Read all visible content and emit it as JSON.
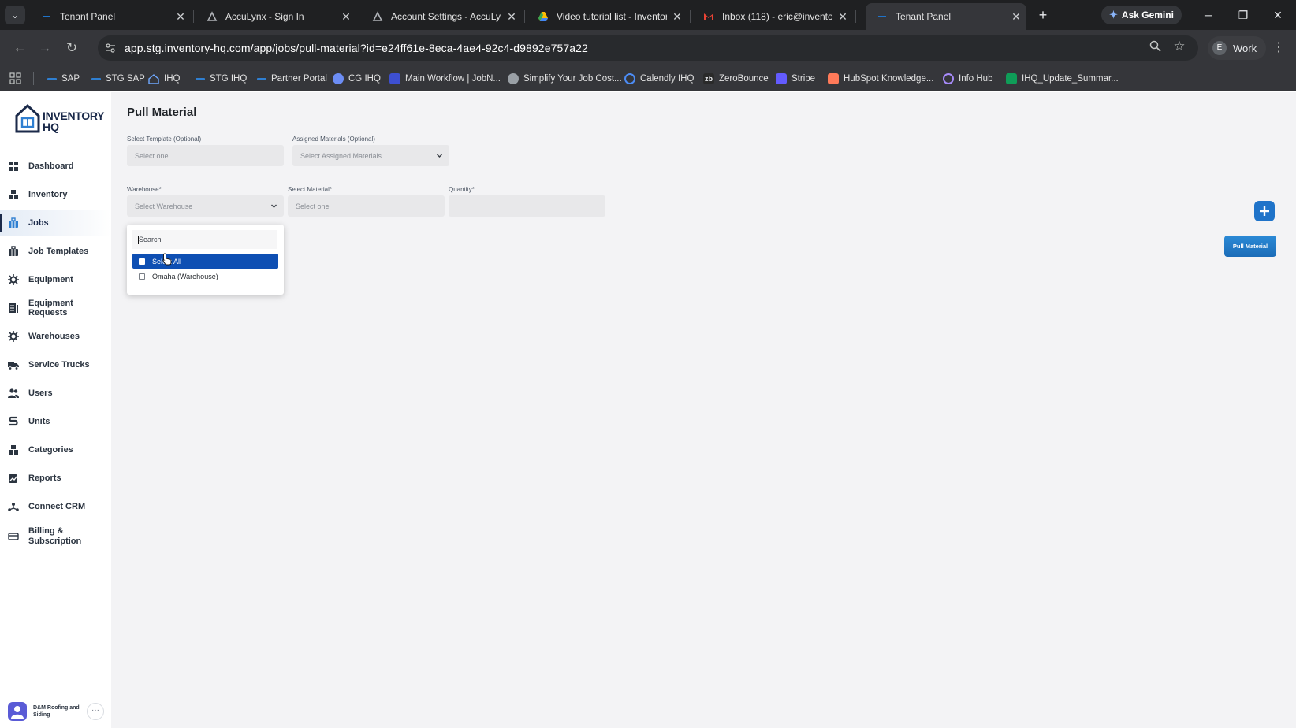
{
  "browser": {
    "tabs": [
      {
        "title": "Tenant Panel",
        "favicon": "ihq-dash-icon",
        "active": false
      },
      {
        "title": "AccuLynx - Sign In",
        "favicon": "acculynx-icon",
        "active": false
      },
      {
        "title": "Account Settings - AccuLynx",
        "favicon": "acculynx-icon",
        "active": false
      },
      {
        "title": "Video tutorial list - InventoryH",
        "favicon": "google-drive-icon",
        "active": false
      },
      {
        "title": "Inbox (118) - eric@inventory-h",
        "favicon": "gmail-icon",
        "active": false
      },
      {
        "title": "Tenant Panel",
        "favicon": "ihq-dash-icon",
        "active": true
      }
    ],
    "new_tab_label": "+",
    "gemini_label": "Ask Gemini",
    "url": "app.stg.inventory-hq.com/app/jobs/pull-material?id=e24ff61e-8eca-4ae4-92c4-d9892e757a22",
    "profile_initial": "E",
    "profile_label": "Work",
    "bookmarks": [
      {
        "label": "SAP"
      },
      {
        "label": "STG SAP"
      },
      {
        "label": "IHQ"
      },
      {
        "label": "STG IHQ"
      },
      {
        "label": "Partner Portal"
      },
      {
        "label": "CG IHQ"
      },
      {
        "label": "Main Workflow | JobN..."
      },
      {
        "label": "Simplify Your Job Cost..."
      },
      {
        "label": "Calendly IHQ"
      },
      {
        "label": "ZeroBounce"
      },
      {
        "label": "Stripe"
      },
      {
        "label": "HubSpot Knowledge..."
      },
      {
        "label": "Info Hub"
      },
      {
        "label": "IHQ_Update_Summar..."
      }
    ]
  },
  "sidebar": {
    "logo_line1": "INVENTORY",
    "logo_line2": "HQ",
    "items": [
      {
        "label": "Dashboard",
        "icon": "dashboard-icon"
      },
      {
        "label": "Inventory",
        "icon": "inventory-icon"
      },
      {
        "label": "Jobs",
        "icon": "jobs-icon",
        "active": true
      },
      {
        "label": "Job Templates",
        "icon": "job-templates-icon"
      },
      {
        "label": "Equipment",
        "icon": "equipment-icon"
      },
      {
        "label": "Equipment Requests",
        "icon": "equipment-requests-icon"
      },
      {
        "label": "Warehouses",
        "icon": "warehouses-icon"
      },
      {
        "label": "Service Trucks",
        "icon": "truck-icon"
      },
      {
        "label": "Users",
        "icon": "users-icon"
      },
      {
        "label": "Units",
        "icon": "units-icon"
      },
      {
        "label": "Categories",
        "icon": "categories-icon"
      },
      {
        "label": "Reports",
        "icon": "reports-icon"
      },
      {
        "label": "Connect CRM",
        "icon": "crm-icon"
      },
      {
        "label_line1": "Billing &",
        "label_line2": "Subscription",
        "icon": "billing-icon"
      }
    ],
    "tenant_name": "D&M Roofing and Siding",
    "more_label": "···"
  },
  "form": {
    "title": "Pull Material",
    "template_label": "Select Template (Optional)",
    "template_placeholder": "Select one",
    "assigned_label": "Assigned Materials (Optional)",
    "assigned_placeholder": "Select Assigned Materials",
    "warehouse_label": "Warehouse*",
    "warehouse_placeholder": "Select Warehouse",
    "material_label": "Select Material*",
    "material_placeholder": "Select one",
    "quantity_label": "Quantity*",
    "quantity_value": "",
    "pull_button": "Pull Material"
  },
  "dropdown": {
    "search_placeholder": "Search",
    "options": [
      {
        "label": "Select All",
        "highlighted": true
      },
      {
        "label": "Omaha (Warehouse)",
        "highlighted": false
      }
    ]
  },
  "colors": {
    "accent": "#1f73c9",
    "highlight": "#0e4fb3",
    "brand_navy": "#1b2a4a"
  }
}
